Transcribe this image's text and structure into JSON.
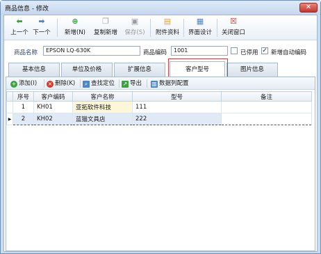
{
  "window": {
    "title": "商品信息 - 修改",
    "close_label": "✕"
  },
  "toolbar": {
    "items": [
      {
        "label": "上一个",
        "icon": "left-arrow-icon"
      },
      {
        "label": "下一个",
        "icon": "right-arrow-icon"
      },
      {
        "label": "新增(N)",
        "icon": "add-icon"
      },
      {
        "label": "复制新增",
        "icon": "copy-icon"
      },
      {
        "label": "保存(S)",
        "icon": "save-icon"
      },
      {
        "label": "附件资料",
        "icon": "attachment-icon"
      },
      {
        "label": "界面设计",
        "icon": "layout-icon"
      },
      {
        "label": "关闭窗口",
        "icon": "close-window-icon"
      }
    ]
  },
  "form": {
    "product_name_label": "商品名称",
    "product_name_value": "EPSON LQ-630K",
    "product_code_label": "商品编码",
    "product_code_value": "1001",
    "disabled_label": "已停用",
    "disabled_checked": false,
    "auto_code_label": "新增自动编码",
    "auto_code_checked": true
  },
  "tabs": [
    {
      "label": "基本信息",
      "active": false
    },
    {
      "label": "单位及价格",
      "active": false
    },
    {
      "label": "扩展信息",
      "active": false
    },
    {
      "label": "客户型号",
      "active": true
    },
    {
      "label": "图片信息",
      "active": false
    }
  ],
  "grid_toolbar": {
    "add": "添加(I)",
    "delete": "删除(K)",
    "find": "查找定位",
    "export": "导出",
    "columns": "数据列配置"
  },
  "table": {
    "columns": [
      "序号",
      "客户编码",
      "客户名称",
      "型号",
      "备注"
    ],
    "rows": [
      {
        "seq": "1",
        "code": "KH01",
        "name": "亚拓软件科技",
        "model": "111",
        "remark": ""
      },
      {
        "seq": "2",
        "code": "KH02",
        "name": "蓝猫文具店",
        "model": "222",
        "remark": ""
      }
    ]
  },
  "colors": {
    "accent_red": "#d6403a",
    "selected_row": "#dfeaf6",
    "label_blue": "#1d3fa3"
  }
}
